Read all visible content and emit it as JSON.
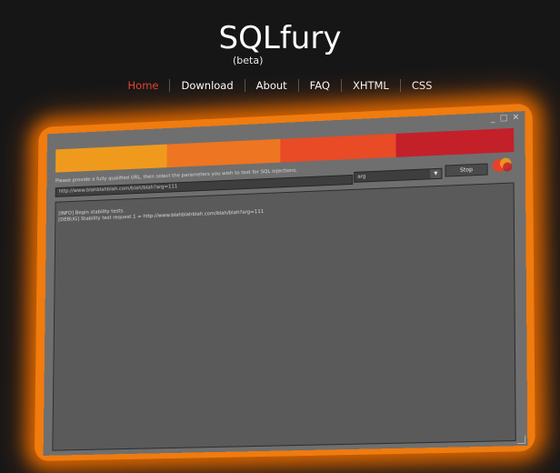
{
  "site": {
    "title": "SQLfury",
    "subtitle": "(beta)"
  },
  "nav": {
    "items": [
      {
        "label": "Home",
        "active": true
      },
      {
        "label": "Download"
      },
      {
        "label": "About"
      },
      {
        "label": "FAQ"
      },
      {
        "label": "XHTML"
      },
      {
        "label": "CSS"
      }
    ]
  },
  "app": {
    "window_controls": [
      "_",
      "□",
      "✕"
    ],
    "color_bar": [
      "#f09a1d",
      "#ee7521",
      "#e84b26",
      "#c3202a"
    ],
    "instructions": "Please provide a fully qualified URL, then select the parameters you wish to test for SQL injections.",
    "url_value": "http://www.blahblahblah.com/blah/blah?arg=111",
    "param_selected": "arg",
    "stop_label": "Stop",
    "log": [
      "[INFO] Begin stability tests.",
      "[DEBUG] Stability test request 1 = http://www.blahblahblah.com/blah/blah?arg=111"
    ]
  },
  "colors": {
    "accent_active": "#e8412b",
    "glow": "#f07b0e",
    "background": "#161616"
  }
}
